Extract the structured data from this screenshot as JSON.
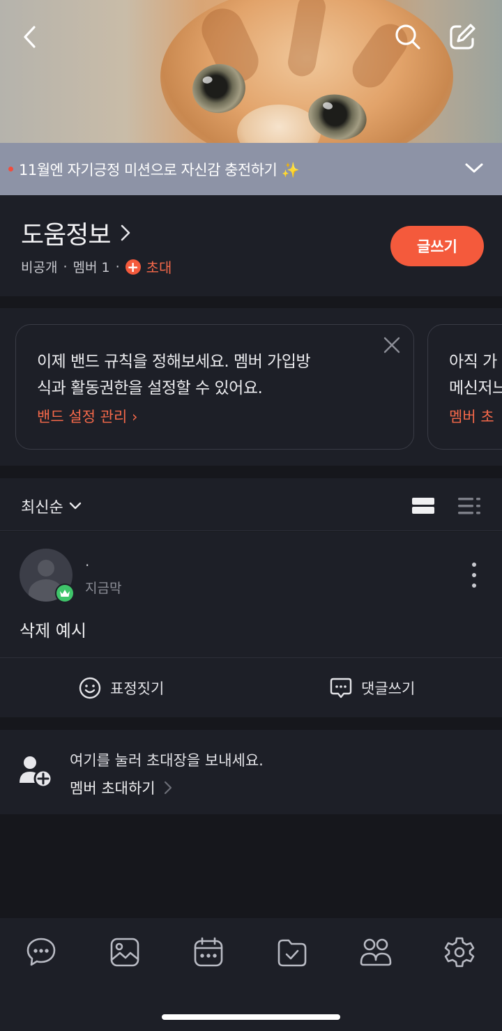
{
  "header": {
    "back_icon": "back-arrow-icon",
    "search_icon": "search-icon",
    "compose_icon": "compose-icon"
  },
  "notice": {
    "text": "11월엔 자기긍정 미션으로 자신감 충전하기 ✨",
    "dot_color": "#f24c3d"
  },
  "band": {
    "title": "도움정보",
    "visibility": "비공개",
    "members": "멤버 1",
    "invite_label": "초대",
    "write_button": "글쓰기",
    "accent": "#f45a3c"
  },
  "tips": [
    {
      "text_line1": "이제 밴드 규칙을 정해보세요. 멤버 가입방",
      "text_line2": "식과 활동권한을 설정할 수 있어요.",
      "link": "밴드 설정 관리 ›"
    },
    {
      "text_line1": "아직 가",
      "text_line2": "메신저느",
      "link": "멤버 초"
    }
  ],
  "sort": {
    "label": "최신순"
  },
  "post": {
    "author": "·",
    "time": "지금막",
    "body": "삭제 예시",
    "emote_label": "표정짓기",
    "comment_label": "댓글쓰기"
  },
  "invite": {
    "line1": "여기를 눌러 초대장을 보내세요.",
    "line2": "멤버 초대하기"
  },
  "bottom_nav": [
    "chat-icon",
    "photo-icon",
    "calendar-icon",
    "folder-check-icon",
    "members-icon",
    "settings-icon"
  ]
}
